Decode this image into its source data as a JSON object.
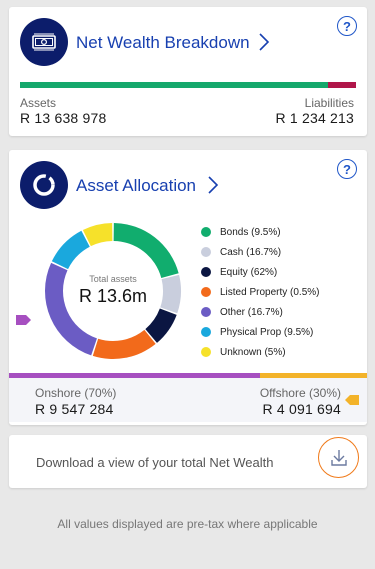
{
  "net_wealth": {
    "title": "Net Wealth Breakdown",
    "icon": "banknote-icon",
    "help_symbol": "?",
    "bar": {
      "assets_fraction": 0.917,
      "assets_color": "#15a86c",
      "liabilities_color": "#b0164a"
    },
    "assets_label": "Assets",
    "assets_value": "R 13 638 978",
    "liabilities_label": "Liabilities",
    "liabilities_value": "R 1 234 213"
  },
  "asset_allocation": {
    "title": "Asset Allocation",
    "icon": "donut-chart-icon",
    "help_symbol": "?",
    "center_caption": "Total assets",
    "center_value": "R 13.6m",
    "legend": [
      {
        "label": "Bonds (9.5%)",
        "color": "#11ad6e"
      },
      {
        "label": "Cash (16.7%)",
        "color": "#c9cedd"
      },
      {
        "label": "Equity (62%)",
        "color": "#0b1642"
      },
      {
        "label": "Listed Property (0.5%)",
        "color": "#f26a1b"
      },
      {
        "label": "Other (16.7%)",
        "color": "#6b5cc4"
      },
      {
        "label": "Physical Prop (9.5%)",
        "color": "#1aa8dd"
      },
      {
        "label": "Unknown (5%)",
        "color": "#f6e12a"
      }
    ],
    "donut_segments": [
      {
        "name": "Bonds",
        "fraction": 0.21,
        "color": "#11ad6e"
      },
      {
        "name": "Cash",
        "fraction": 0.095,
        "color": "#c9cedd"
      },
      {
        "name": "Equity",
        "fraction": 0.085,
        "color": "#0b1642"
      },
      {
        "name": "Listed Property",
        "fraction": 0.16,
        "color": "#f26a1b"
      },
      {
        "name": "Other",
        "fraction": 0.27,
        "color": "#6b5cc4"
      },
      {
        "name": "Physical Prop",
        "fraction": 0.105,
        "color": "#1aa8dd"
      },
      {
        "name": "Unknown",
        "fraction": 0.075,
        "color": "#f6e12a"
      }
    ],
    "onshore_offshore_bar": {
      "onshore_fraction": 0.7,
      "onshore_color": "#a64fc0",
      "offshore_color": "#f3b32a"
    },
    "onshore_label": "Onshore (70%)",
    "onshore_value": "R 9 547 284",
    "offshore_label": "Offshore (30%)",
    "offshore_value": "R 4 091 694"
  },
  "download": {
    "text": "Download a view of your total Net Wealth",
    "icon": "download-icon"
  },
  "footer_note": "All values displayed are pre-tax where applicable"
}
